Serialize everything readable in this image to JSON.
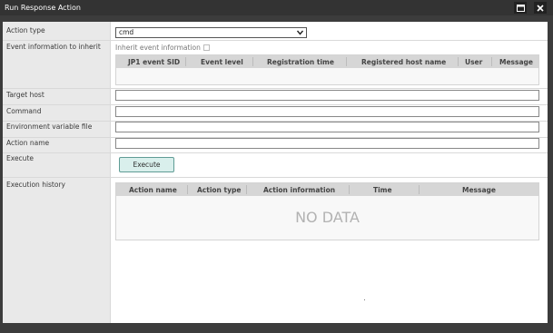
{
  "window": {
    "title": "Run Response Action",
    "maximize_icon": "maximize-icon",
    "close_icon": "close-icon"
  },
  "labels": {
    "action_type": "Action type",
    "event_info": "Event information to inherit",
    "target_host": "Target host",
    "command": "Command",
    "env_file": "Environment variable file",
    "action_name": "Action name",
    "execute": "Execute",
    "history": "Execution history"
  },
  "action_type": {
    "value": "cmd"
  },
  "inherit": {
    "label": "Inherit event information",
    "checked": false
  },
  "event_table": {
    "columns": [
      "JP1 event SID",
      "Event level",
      "Registration time",
      "Registered host name",
      "User",
      "Message"
    ],
    "rows": []
  },
  "fields": {
    "target_host": "",
    "command": "",
    "env_file": "",
    "action_name": ""
  },
  "buttons": {
    "execute": "Execute"
  },
  "history_table": {
    "columns": [
      "Action name",
      "Action type",
      "Action information",
      "Time",
      "Message"
    ],
    "rows": [],
    "empty_text": "NO DATA"
  },
  "colors": {
    "accent": "#5f9c95",
    "button_fill": "#d9efec",
    "titlebar": "#333333"
  }
}
